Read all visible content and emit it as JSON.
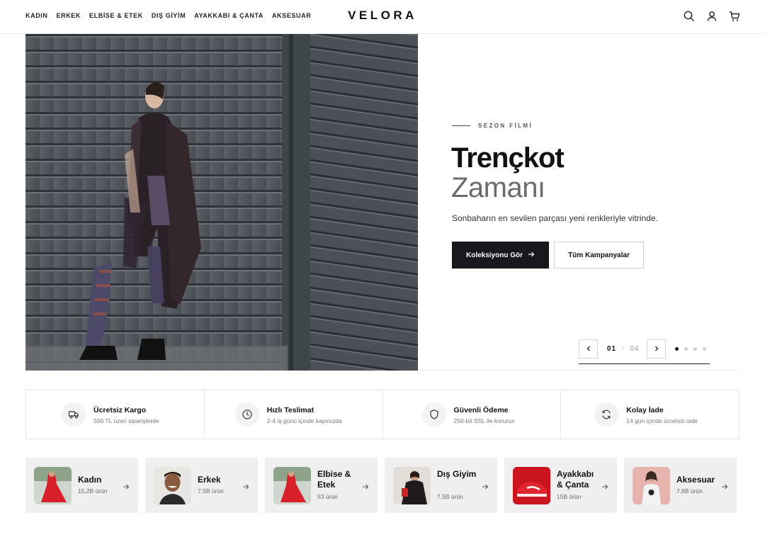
{
  "header": {
    "nav": [
      "KADIN",
      "ERKEK",
      "ELBİSE & ETEK",
      "DIŞ GİYİM",
      "AYAKKABI & ÇANTA",
      "AKSESUAR"
    ],
    "logo": "VELORA",
    "icons": [
      "search-icon",
      "user-icon",
      "cart-icon"
    ]
  },
  "hero": {
    "eyebrow": "SEZON FİLMİ",
    "title_line1": "Trençkot",
    "title_line2": "Zamanı",
    "subtitle": "Sonbaharın en sevilen parçası yeni renkleriyle vitrinde.",
    "primary_button": "Koleksiyonu Gör",
    "secondary_button": "Tüm Kampanyalar",
    "slide_current": "01",
    "slide_separator": "/",
    "slide_total": "04",
    "active_dot": 0,
    "dot_count": 4
  },
  "features": [
    {
      "title": "Ücretsiz Kargo",
      "desc": "500 TL üzeri siparişlerde",
      "icon": "truck-icon"
    },
    {
      "title": "Hızlı Teslimat",
      "desc": "2-4 iş günü içinde kapınızda",
      "icon": "clock-icon"
    },
    {
      "title": "Güvenli Ödeme",
      "desc": "256-bit SSL ile korunur",
      "icon": "shield-icon"
    },
    {
      "title": "Kolay İade",
      "desc": "14 gün içinde ücretsiz iade",
      "icon": "refresh-icon"
    }
  ],
  "categories": [
    {
      "name": "Kadın",
      "count": "15,2B ürün"
    },
    {
      "name": "Erkek",
      "count": "7,5B ürün"
    },
    {
      "name": "Elbise & Etek",
      "count": "53 ürün"
    },
    {
      "name": "Dış Giyim",
      "count": "7,5B ürün"
    },
    {
      "name": "Ayakkabı & Çanta",
      "count": "15B ürün"
    },
    {
      "name": "Aksesuar",
      "count": "7,6B ürün"
    }
  ],
  "colors": {
    "primary": "#16181b",
    "muted_title": "#6b6b6b",
    "panel_bg": "#efefef",
    "accent_red": "#d8202a"
  }
}
